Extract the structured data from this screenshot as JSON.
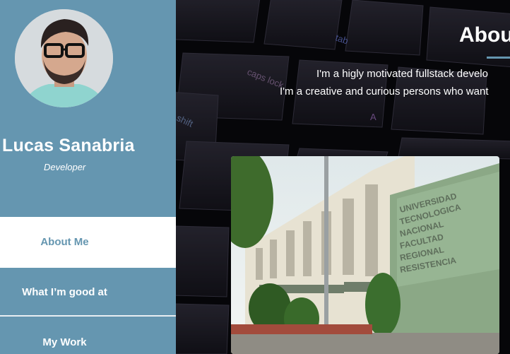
{
  "profile": {
    "name": "Lucas Sanabria",
    "role": "Developer",
    "avatar_icon": "person-photo"
  },
  "nav": {
    "items": [
      {
        "label": "About Me",
        "active": true
      },
      {
        "label": "What I’m good at",
        "active": false
      },
      {
        "label": "My Work",
        "active": false
      }
    ]
  },
  "about": {
    "title": "About",
    "line1": "I'm a higly motivated fullstack develo",
    "line2": "I'm a creative and curious persons who want"
  },
  "photo": {
    "sign_text": "UNIVERSIDAD TECNOLOGICA NACIONAL FACULTAD REGIONAL RESISTENCIA"
  },
  "colors": {
    "sidebar": "#6596b0",
    "accent": "#6596b0",
    "text": "#ffffff"
  }
}
